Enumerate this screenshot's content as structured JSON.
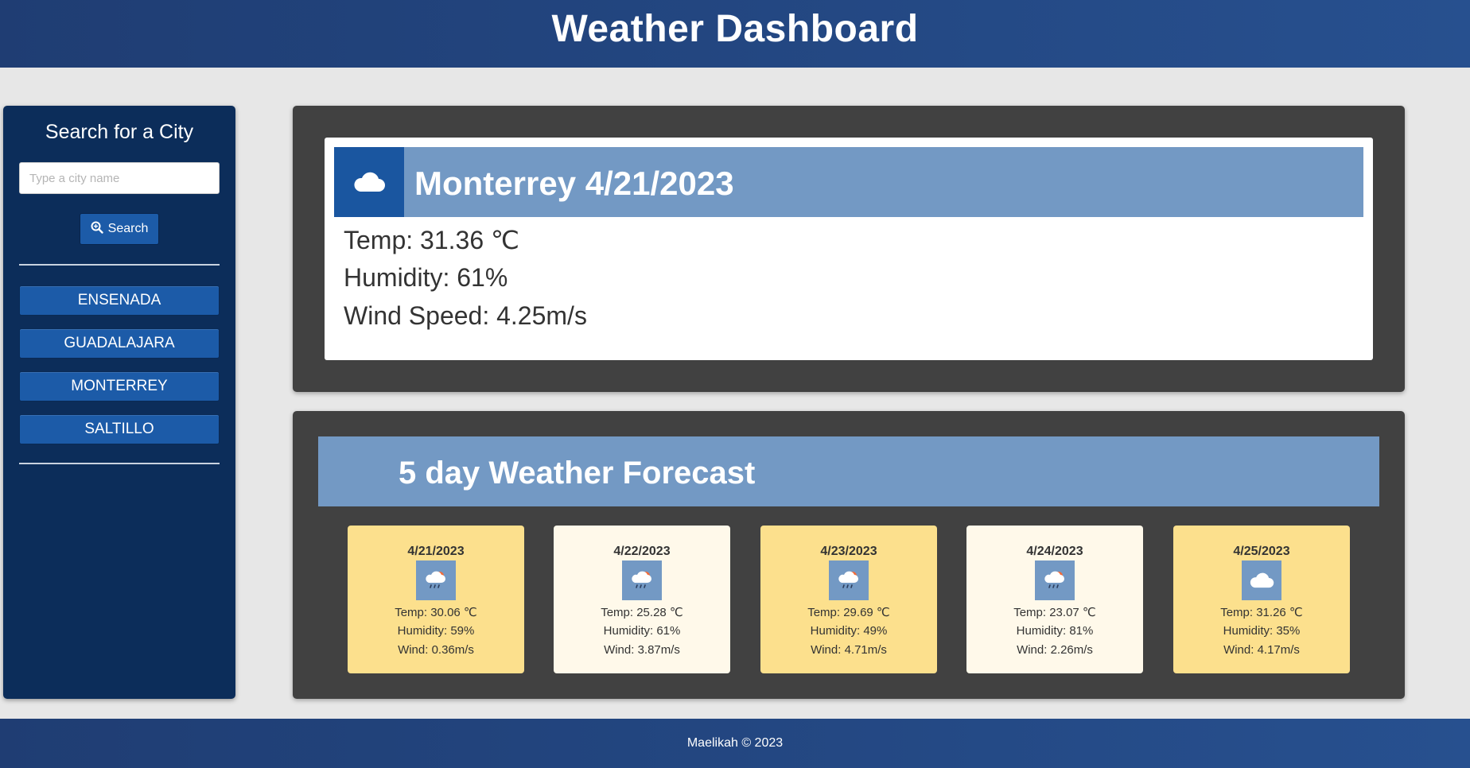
{
  "header": {
    "title": "Weather Dashboard"
  },
  "sidebar": {
    "heading": "Search for a City",
    "search_placeholder": "Type a city name",
    "search_button": "Search",
    "cities": [
      "ENSENADA",
      "GUADALAJARA",
      "MONTERREY",
      "SALTILLO"
    ]
  },
  "current": {
    "title": "Monterrey 4/21/2023",
    "icon": "cloud-icon",
    "temp": "Temp: 31.36 ℃",
    "humidity": "Humidity: 61%",
    "wind": "Wind Speed: 4.25m/s"
  },
  "forecast": {
    "heading": "5 day Weather Forecast",
    "days": [
      {
        "date": "4/21/2023",
        "icon": "rain-sun-icon",
        "temp": "Temp: 30.06 ℃",
        "humidity": "Humidity: 59%",
        "wind": "Wind: 0.36m/s"
      },
      {
        "date": "4/22/2023",
        "icon": "rain-sun-icon",
        "temp": "Temp: 25.28 ℃",
        "humidity": "Humidity: 61%",
        "wind": "Wind: 3.87m/s"
      },
      {
        "date": "4/23/2023",
        "icon": "rain-sun-icon",
        "temp": "Temp: 29.69 ℃",
        "humidity": "Humidity: 49%",
        "wind": "Wind: 4.71m/s"
      },
      {
        "date": "4/24/2023",
        "icon": "rain-sun-icon",
        "temp": "Temp: 23.07 ℃",
        "humidity": "Humidity: 81%",
        "wind": "Wind: 2.26m/s"
      },
      {
        "date": "4/25/2023",
        "icon": "cloud-icon",
        "temp": "Temp: 31.26 ℃",
        "humidity": "Humidity: 35%",
        "wind": "Wind: 4.17m/s"
      }
    ]
  },
  "footer": {
    "text": "Maelikah © 2023"
  },
  "colors": {
    "header_bg": "#1f3d73",
    "sidebar_bg": "#0c2d5a",
    "accent_blue": "#1c5ba8",
    "panel_bg": "#414141",
    "title_bar": "#7399c4",
    "card_yellow": "#fce08d",
    "card_cream": "#fff9ea"
  }
}
